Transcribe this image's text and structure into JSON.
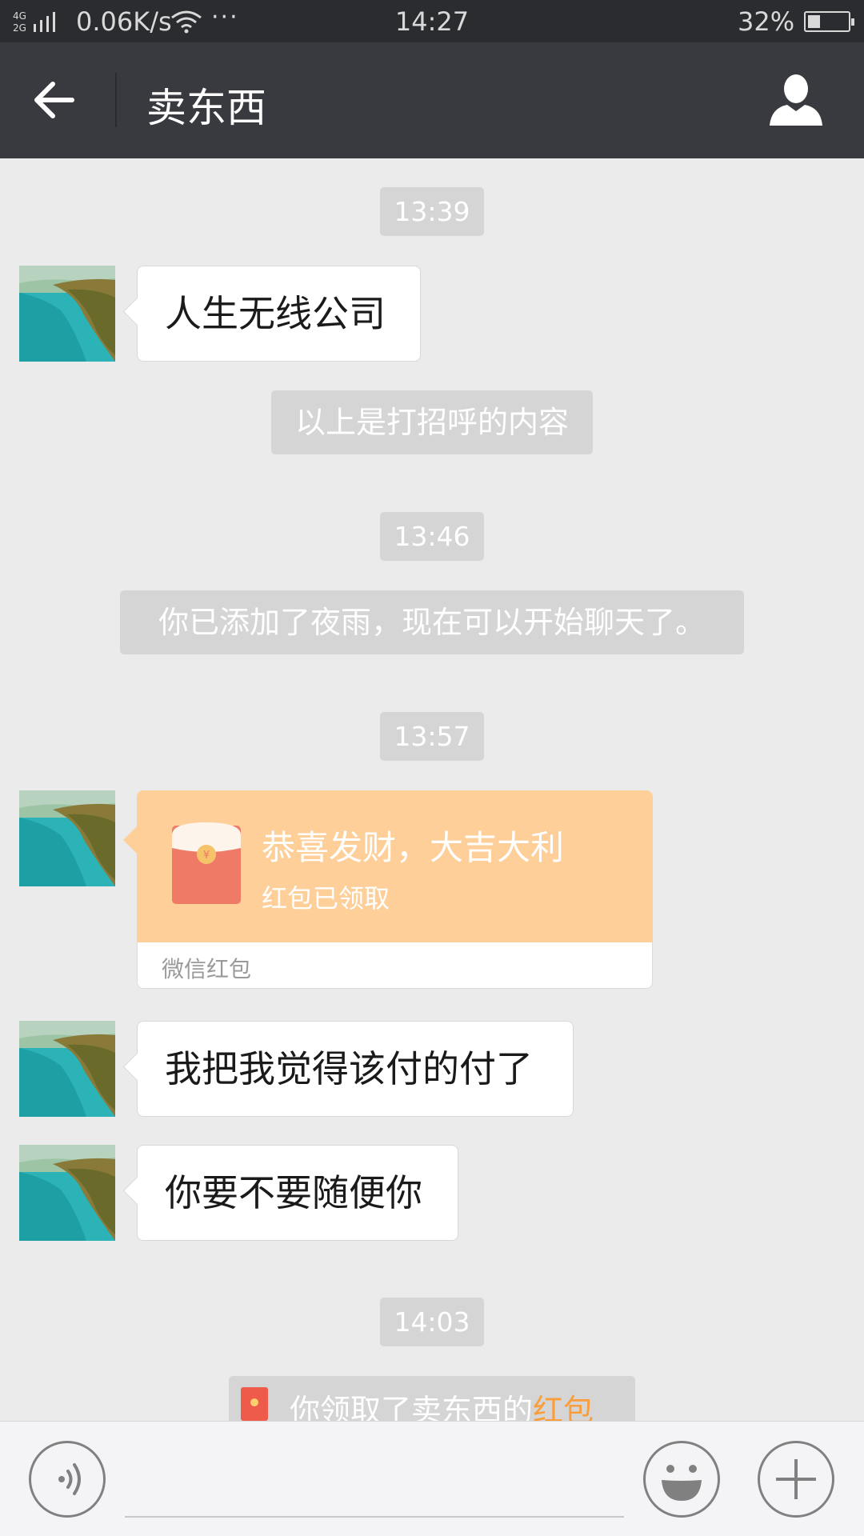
{
  "status_bar": {
    "network_speed": "0.06K/s",
    "dots": "···",
    "time": "14:27",
    "battery_percent": "32%",
    "signal_icon": "signal-4g2g-icon",
    "wifi_icon": "wifi-icon",
    "battery_icon": "battery-icon"
  },
  "header": {
    "title": "卖东西",
    "back_icon": "back-arrow-icon",
    "profile_icon": "person-icon"
  },
  "messages": {
    "time1": "13:39",
    "msg1": "人生无线公司",
    "sys1": "以上是打招呼的内容",
    "time2": "13:46",
    "sys2": "你已添加了夜雨，现在可以开始聊天了。",
    "time3": "13:57",
    "red_packet": {
      "wish": "恭喜发财，大吉大利",
      "status": "红包已领取",
      "brand": "微信红包"
    },
    "msg2": "我把我觉得该付的付了",
    "msg3": "你要不要随便你",
    "time4": "14:03",
    "notice_prefix": "你领取了卖东西的",
    "notice_link": "红包"
  },
  "input_bar": {
    "voice_icon": "voice-icon",
    "emoji_icon": "emoji-icon",
    "plus_icon": "plus-icon"
  },
  "colors": {
    "header_bg": "#393a3f",
    "chat_bg": "#ebebeb",
    "red_packet_bg": "#fecf98",
    "link_orange": "#fa9d3b"
  }
}
